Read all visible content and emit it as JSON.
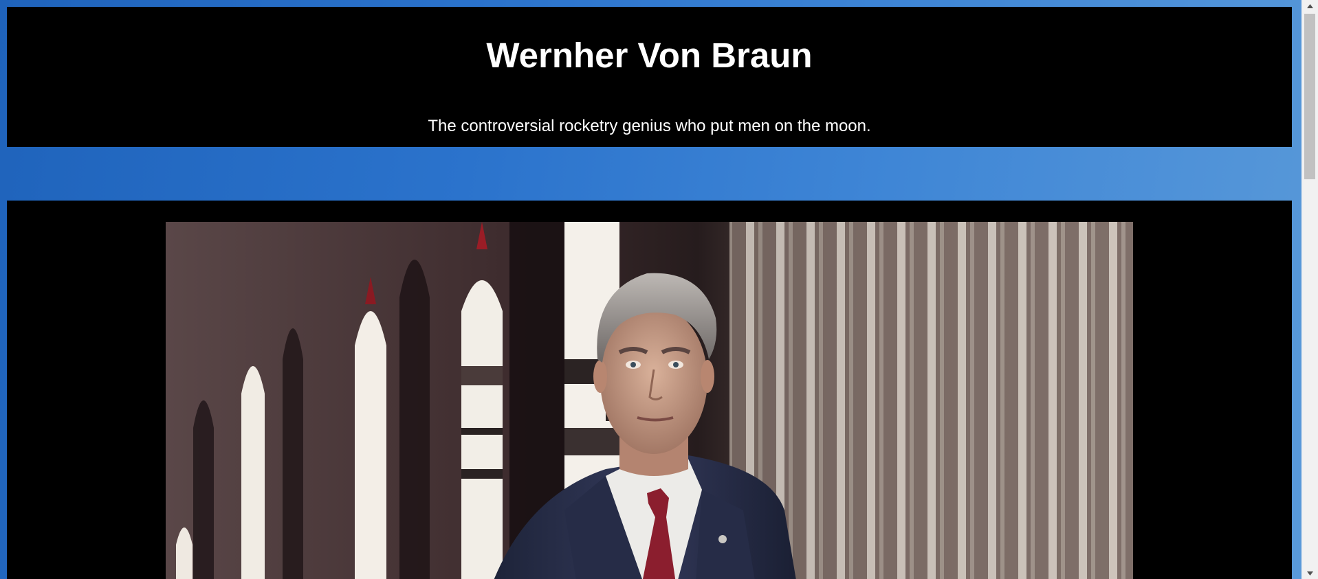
{
  "header": {
    "title": "Wernher Von Braun",
    "subtitle": "The controversial rocketry genius who put men on the moon."
  },
  "main": {
    "photo_subject": "portrait photograph of a man in suit and red tie with model rockets behind"
  },
  "colors": {
    "page_background": "#2b73cc",
    "panel_background": "#000000",
    "text": "#ffffff",
    "scrollbar_track": "#f1f1f1",
    "scrollbar_thumb": "#c1c1c1"
  },
  "icons": {
    "scroll_up": "triangle-up-icon",
    "scroll_down": "triangle-down-icon"
  }
}
